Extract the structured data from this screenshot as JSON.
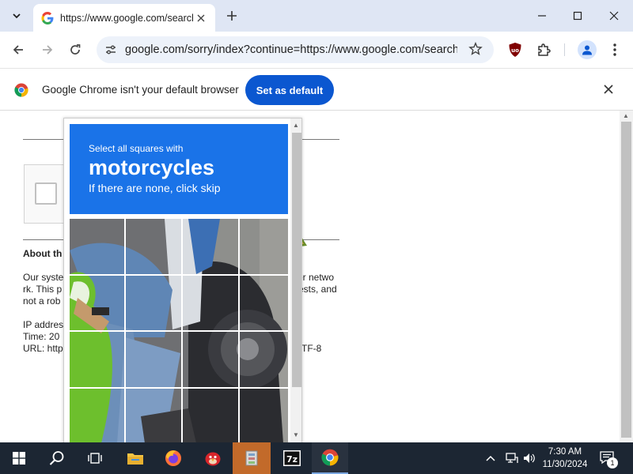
{
  "browser": {
    "tab": {
      "title": "https://www.google.com/search",
      "icon": "google-icon"
    },
    "address": {
      "url": "google.com/sorry/index?continue=https://www.google.com/search"
    },
    "infobar": {
      "message": "Google Chrome isn't your default browser",
      "button_label": "Set as default"
    }
  },
  "page": {
    "about_heading": "About th",
    "paragraph_lines": [
      "Our syste",
      "rk. This p",
      "not a rob"
    ],
    "paragraph_right_lines": [
      "er netwo",
      "ests, and"
    ],
    "ip_label": "IP addres",
    "time_label": "Time: 20",
    "url_label": "URL: http",
    "url_tail": "TF-8"
  },
  "captcha": {
    "instruction_line1": "Select all squares with",
    "target_word": "motorcycles",
    "instruction_line3": "If there are none, click skip",
    "grid_rows": 4,
    "grid_cols": 4
  },
  "taskbar": {
    "time": "7:30 AM",
    "date": "11/30/2024",
    "notification_count": "1",
    "apps": [
      "start",
      "search",
      "task-view",
      "file-explorer",
      "firefox",
      "angry-birds",
      "archive-app",
      "7zip",
      "chrome"
    ]
  },
  "colors": {
    "captcha_blue": "#1a73e8",
    "chrome_button_blue": "#0b57d0",
    "taskbar": "#1c2633"
  }
}
